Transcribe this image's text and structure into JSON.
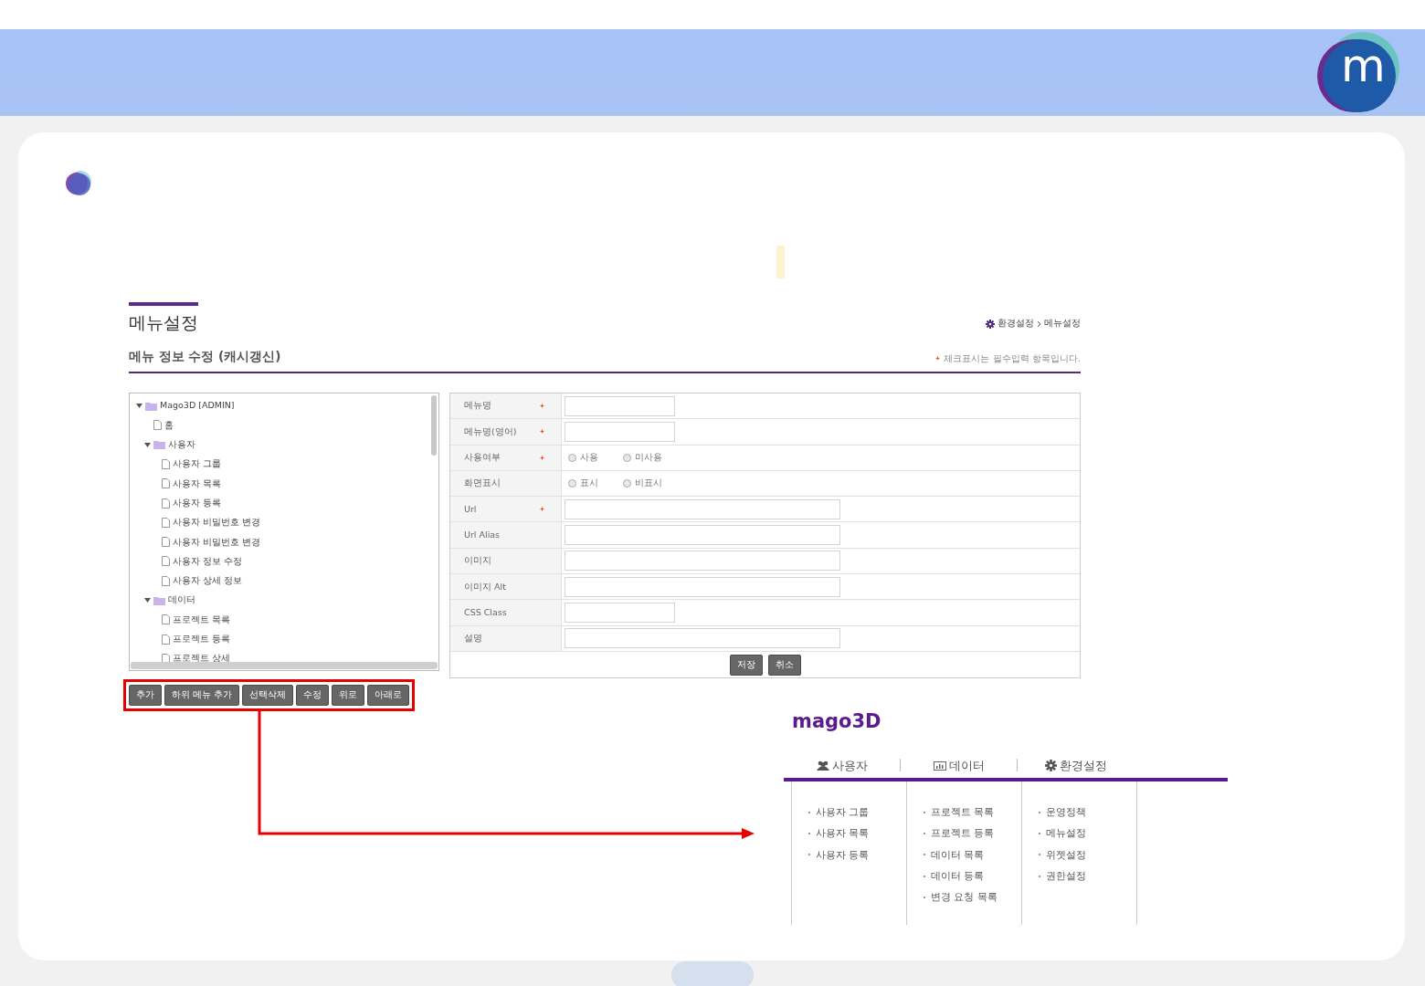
{
  "header": {
    "logo_letter": "m"
  },
  "page": {
    "title": "메뉴설정",
    "breadcrumb": [
      "환경설정",
      "메뉴설정"
    ],
    "subtitle": "메뉴 정보 수정 (캐시갱신)",
    "required_note": "체크표시는 필수입력 항목입니다."
  },
  "tree": [
    {
      "label": "Mago3D [ADMIN]",
      "kind": "folder",
      "expanded": true,
      "children": [
        {
          "label": "홈",
          "kind": "page"
        },
        {
          "label": "사용자",
          "kind": "folder",
          "expanded": true,
          "children": [
            {
              "label": "사용자 그룹",
              "kind": "page"
            },
            {
              "label": "사용자 목록",
              "kind": "page"
            },
            {
              "label": "사용자 등록",
              "kind": "page"
            },
            {
              "label": "사용자 비밀번호 변경",
              "kind": "page"
            },
            {
              "label": "사용자 비밀번호 변경",
              "kind": "page"
            },
            {
              "label": "사용자 정보 수정",
              "kind": "page"
            },
            {
              "label": "사용자 상세 정보",
              "kind": "page"
            }
          ]
        },
        {
          "label": "데이터",
          "kind": "folder",
          "expanded": true,
          "children": [
            {
              "label": "프로젝트 목록",
              "kind": "page"
            },
            {
              "label": "프로젝트 등록",
              "kind": "page"
            },
            {
              "label": "프로젝트 상세",
              "kind": "page"
            }
          ]
        }
      ]
    }
  ],
  "tree_buttons": [
    "추가",
    "하위 메뉴 추가",
    "선택삭제",
    "수정",
    "위로",
    "아래로"
  ],
  "form": [
    {
      "label": "메뉴명",
      "required": true,
      "kind": "short"
    },
    {
      "label": "메뉴명(영어)",
      "required": true,
      "kind": "short"
    },
    {
      "label": "사용여부",
      "required": true,
      "kind": "radio",
      "options": [
        {
          "label": "사용",
          "selected": false
        },
        {
          "label": "미사용",
          "selected": false
        }
      ]
    },
    {
      "label": "화면표시",
      "required": false,
      "kind": "radio",
      "options": [
        {
          "label": "표시",
          "selected": false
        },
        {
          "label": "비표시",
          "selected": false
        }
      ]
    },
    {
      "label": "Url",
      "required": true,
      "kind": "long"
    },
    {
      "label": "Url Alias",
      "required": false,
      "kind": "long"
    },
    {
      "label": "이미지",
      "required": false,
      "kind": "long"
    },
    {
      "label": "이미지 Alt",
      "required": false,
      "kind": "long"
    },
    {
      "label": "CSS Class",
      "required": false,
      "kind": "short"
    },
    {
      "label": "설명",
      "required": false,
      "kind": "long"
    }
  ],
  "form_buttons": [
    "저장",
    "취소"
  ],
  "preview": {
    "title": "mago3D",
    "tabs": [
      {
        "label": "사용자"
      },
      {
        "label": "데이터"
      },
      {
        "label": "환경설정"
      }
    ],
    "columns": [
      [
        "사용자 그룹",
        "사용자 목록",
        "사용자 등록"
      ],
      [
        "프로젝트 목록",
        "프로젝트 등록",
        "데이터 목록",
        "데이터 등록",
        "변경 요청 목록"
      ],
      [
        "운영정책",
        "메뉴설정",
        "위젯설정",
        "권한설정"
      ]
    ]
  }
}
